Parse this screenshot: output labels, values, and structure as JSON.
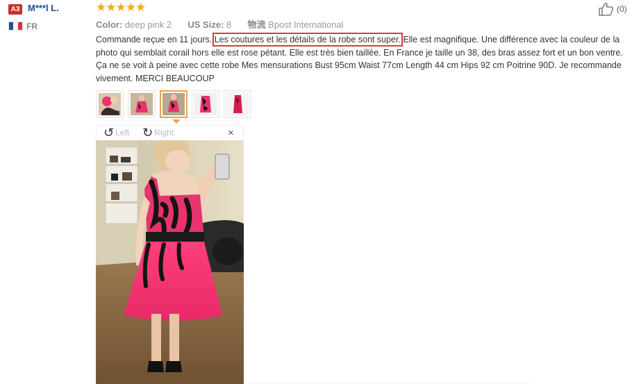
{
  "reviewer": {
    "badge": "A3",
    "name": "M***l L.",
    "country": "FR",
    "flag_colors": [
      "#1f4fa3",
      "#ffffff",
      "#e03131"
    ]
  },
  "rating": {
    "stars": 5,
    "max": 5,
    "display": "★★★★★"
  },
  "meta": {
    "color_label": "Color:",
    "color_value": "deep pink 2",
    "size_label": "US Size:",
    "size_value": "8",
    "shipping_label": "物流",
    "shipping_value": "Bpost International"
  },
  "helpful": {
    "icon": "thumbs-up-icon",
    "count": "(0)"
  },
  "review": {
    "before": "Commande reçue en 11 jours. ",
    "highlight": "Les coutures et les détails de la robe sont super.",
    "after": " Elle est magnifique. Une différence avec la couleur de la photo qui semblait corail hors elle est rose pétant. Elle est très bien taillée. En France je taille un 38, des bras assez fort et un bon ventre. Ça ne se voit à peine avec cette robe Mes mensurations Bust 95cm Waist 77cm Length 44 cm Hips 92 cm Poitrine 90D. Je recommande vivement. MERCI BEAUCOUP",
    "highlight_color": "#d83a3a"
  },
  "thumbnails": {
    "count": 5,
    "active_index": 2
  },
  "viewer": {
    "rotate_left_label": "Left",
    "rotate_right_label": "Right",
    "close_label": "×"
  },
  "colors": {
    "reviewer_name": "#1a4d99",
    "stars": "#f5a623",
    "dress_pink": "#e8336d",
    "accent_orange": "#f0a050"
  }
}
